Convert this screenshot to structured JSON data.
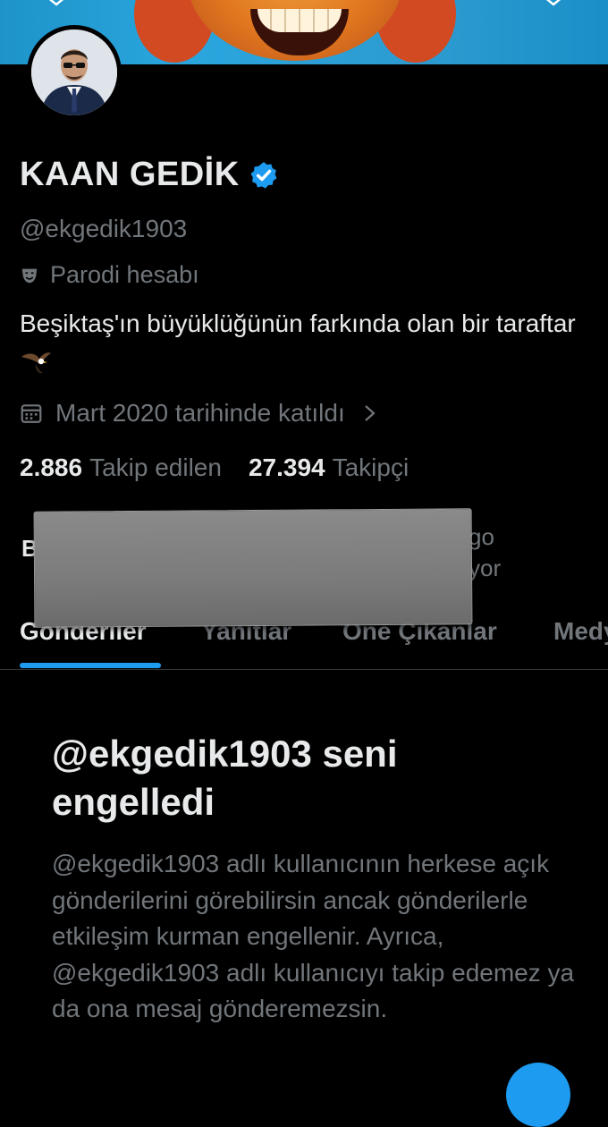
{
  "profile": {
    "name": "KAAN GEDİK",
    "handle": "@ekgedik1903",
    "parody_label": "Parodi hesabı",
    "bio": "Beşiktaş'ın büyüklüğünün farkında olan bir taraftar",
    "joined": "Mart 2020 tarihinde katıldı",
    "following_count": "2.886",
    "following_label": "Takip edilen",
    "followers_count": "27.394",
    "followers_label": "Takipçi"
  },
  "followed_by": {
    "lead": "B",
    "right_line1": "go",
    "right_line2": "yor"
  },
  "tabs": [
    {
      "label": "Gönderiler"
    },
    {
      "label": "Yanıtlar"
    },
    {
      "label": "Öne Çıkanlar"
    },
    {
      "label": "Medya"
    }
  ],
  "blocked": {
    "title": "@ekgedik1903 seni engelledi",
    "description": "@ekgedik1903 adlı kullanıcının herkese açık gönderilerini görebilirsin ancak gönderilerle etkileşim kurman engellenir. Ayrıca, @ekgedik1903 adlı kullanıcıyı takip edemez ya da ona mesaj gönderemezsin."
  },
  "colors": {
    "background": "#000000",
    "accent": "#1d9bf0",
    "text_primary": "#e7e9ea",
    "text_secondary": "#71767b",
    "redaction": "#7b7b7b"
  },
  "icons": {
    "verified": "verified-badge-icon",
    "parody": "theater-mask-icon",
    "bio_emoji": "eagle-icon",
    "joined": "calendar-icon",
    "joined_more": "chevron-right-icon",
    "compose": "compose-fab-icon"
  }
}
